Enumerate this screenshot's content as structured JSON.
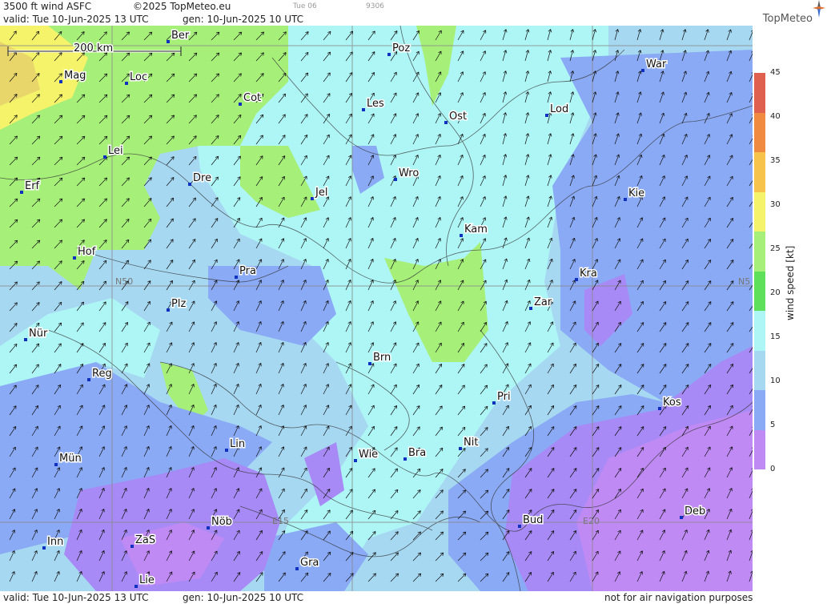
{
  "header": {
    "product": "3500 ft wind ASFC",
    "copyright": "©2025 TopMeteo.eu",
    "run_note": "Tue 06",
    "code": "9306",
    "valid": "valid:  Tue  10-Jun-2025  13 UTC",
    "generated": "gen:  10-Jun-2025 10 UTC",
    "brand": "TopMeteo"
  },
  "footer": {
    "valid": "valid:  Tue  10-Jun-2025  13 UTC",
    "generated": "gen:  10-Jun-2025 10 UTC",
    "disclaimer": "not for air navigation purposes"
  },
  "map": {
    "scale_label": "200 km",
    "grid_labels": [
      "N50",
      "N5",
      "E15",
      "E20"
    ],
    "cities": [
      "Ber",
      "Poz",
      "War",
      "Mag",
      "Loc",
      "Cot",
      "Les",
      "Ost",
      "Lod",
      "Lei",
      "Erf",
      "Dre",
      "Wro",
      "Jel",
      "Kie",
      "Kam",
      "Hof",
      "Pra",
      "Kra",
      "Zar",
      "Plz",
      "Nür",
      "Brn",
      "Reg",
      "Pri",
      "Kos",
      "Lin",
      "Mün",
      "Wie",
      "Bra",
      "Nit",
      "Inn",
      "ZaS",
      "Nöb",
      "Bud",
      "Deb",
      "Gra",
      "Lie"
    ]
  },
  "legend": {
    "title": "wind  speed  [kt]",
    "ticks": [
      "45",
      "40",
      "35",
      "30",
      "25",
      "20",
      "15",
      "10",
      "5",
      "0"
    ],
    "colors": [
      "#e06050",
      "#f08a40",
      "#f7c34a",
      "#f5f36a",
      "#a6f07a",
      "#5fe05a",
      "#aef5f5",
      "#a6d8f2",
      "#8aaaf5",
      "#c08af5"
    ]
  }
}
